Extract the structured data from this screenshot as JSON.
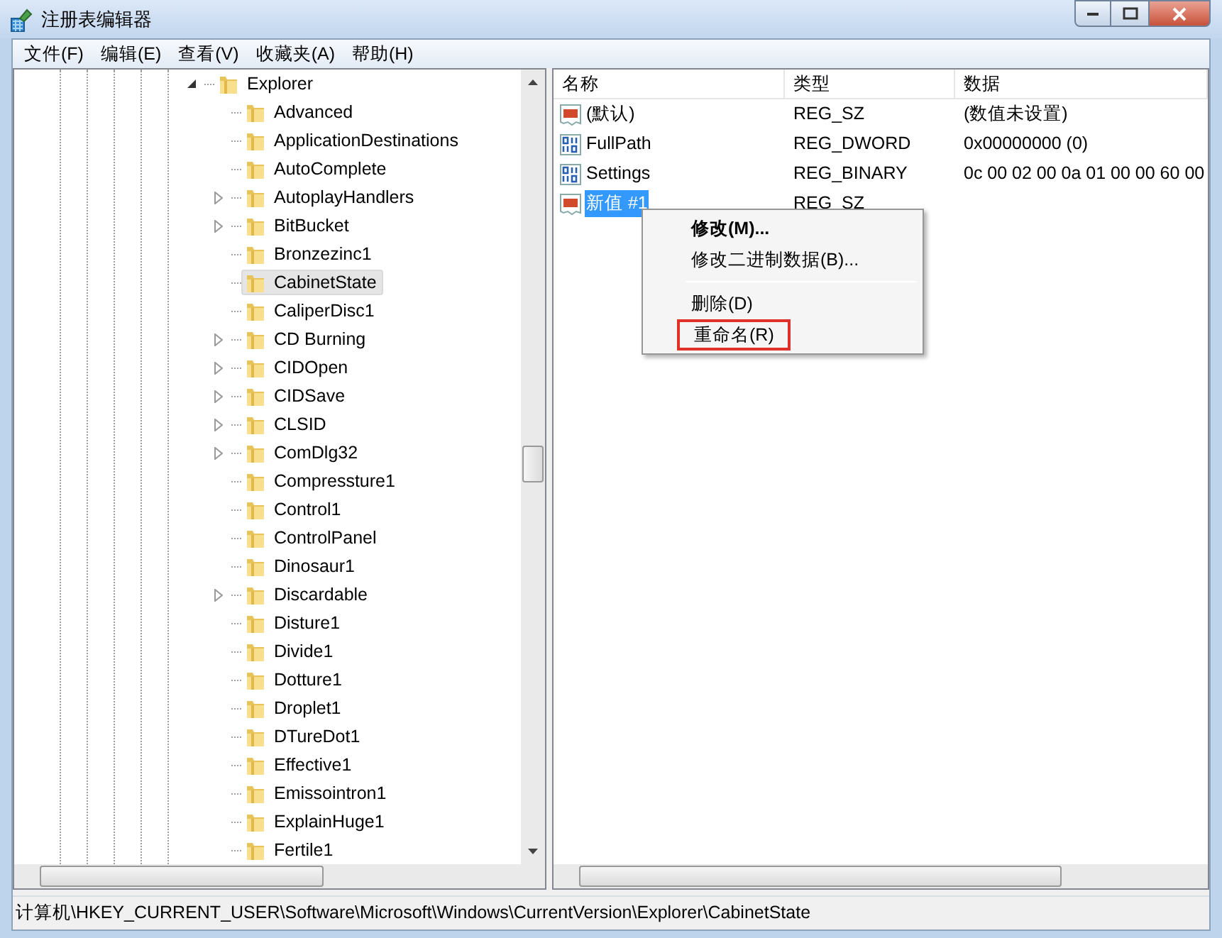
{
  "window": {
    "title": "注册表编辑器"
  },
  "menu": [
    "文件(F)",
    "编辑(E)",
    "查看(V)",
    "收藏夹(A)",
    "帮助(H)"
  ],
  "tree": [
    {
      "label": "Explorer",
      "expanded": true,
      "selected": false,
      "children": [
        {
          "label": "Advanced",
          "expandable": false,
          "selected": false
        },
        {
          "label": "ApplicationDestinations",
          "expandable": false,
          "selected": false
        },
        {
          "label": "AutoComplete",
          "expandable": false,
          "selected": false
        },
        {
          "label": "AutoplayHandlers",
          "expandable": true,
          "selected": false
        },
        {
          "label": "BitBucket",
          "expandable": true,
          "selected": false
        },
        {
          "label": "Bronzezinc1",
          "expandable": false,
          "selected": false
        },
        {
          "label": "CabinetState",
          "expandable": false,
          "selected": true
        },
        {
          "label": "CaliperDisc1",
          "expandable": false,
          "selected": false
        },
        {
          "label": "CD Burning",
          "expandable": true,
          "selected": false
        },
        {
          "label": "CIDOpen",
          "expandable": true,
          "selected": false
        },
        {
          "label": "CIDSave",
          "expandable": true,
          "selected": false
        },
        {
          "label": "CLSID",
          "expandable": true,
          "selected": false
        },
        {
          "label": "ComDlg32",
          "expandable": true,
          "selected": false
        },
        {
          "label": "Compressture1",
          "expandable": false,
          "selected": false
        },
        {
          "label": "Control1",
          "expandable": false,
          "selected": false
        },
        {
          "label": "ControlPanel",
          "expandable": false,
          "selected": false
        },
        {
          "label": "Dinosaur1",
          "expandable": false,
          "selected": false
        },
        {
          "label": "Discardable",
          "expandable": true,
          "selected": false
        },
        {
          "label": "Disture1",
          "expandable": false,
          "selected": false
        },
        {
          "label": "Divide1",
          "expandable": false,
          "selected": false
        },
        {
          "label": "Dotture1",
          "expandable": false,
          "selected": false
        },
        {
          "label": "Droplet1",
          "expandable": false,
          "selected": false
        },
        {
          "label": "DTureDot1",
          "expandable": false,
          "selected": false
        },
        {
          "label": "Effective1",
          "expandable": false,
          "selected": false
        },
        {
          "label": "Emissointron1",
          "expandable": false,
          "selected": false
        },
        {
          "label": "ExplainHuge1",
          "expandable": false,
          "selected": false
        },
        {
          "label": "Fertile1",
          "expandable": false,
          "selected": false
        }
      ]
    }
  ],
  "values": {
    "columns": [
      "名称",
      "类型",
      "数据"
    ],
    "rows": [
      {
        "kind": "string",
        "name": "(默认)",
        "type": "REG_SZ",
        "data": "(数值未设置)",
        "selected": false
      },
      {
        "kind": "binary",
        "name": "FullPath",
        "type": "REG_DWORD",
        "data": "0x00000000 (0)",
        "selected": false
      },
      {
        "kind": "binary",
        "name": "Settings",
        "type": "REG_BINARY",
        "data": "0c 00 02 00 0a 01 00 00 60 00",
        "selected": false
      },
      {
        "kind": "string",
        "name": "新值 #1",
        "type": "REG_SZ",
        "data": "",
        "selected": true
      }
    ]
  },
  "context_menu": [
    {
      "kind": "item",
      "label": "修改(M)...",
      "default": true,
      "highlighted": false
    },
    {
      "kind": "item",
      "label": "修改二进制数据(B)...",
      "default": false,
      "highlighted": false
    },
    {
      "kind": "separator"
    },
    {
      "kind": "item",
      "label": "删除(D)",
      "default": false,
      "highlighted": false
    },
    {
      "kind": "item",
      "label": "重命名(R)",
      "default": false,
      "highlighted": true
    }
  ],
  "status_bar": "计算机\\HKEY_CURRENT_USER\\Software\\Microsoft\\Windows\\CurrentVersion\\Explorer\\CabinetState"
}
